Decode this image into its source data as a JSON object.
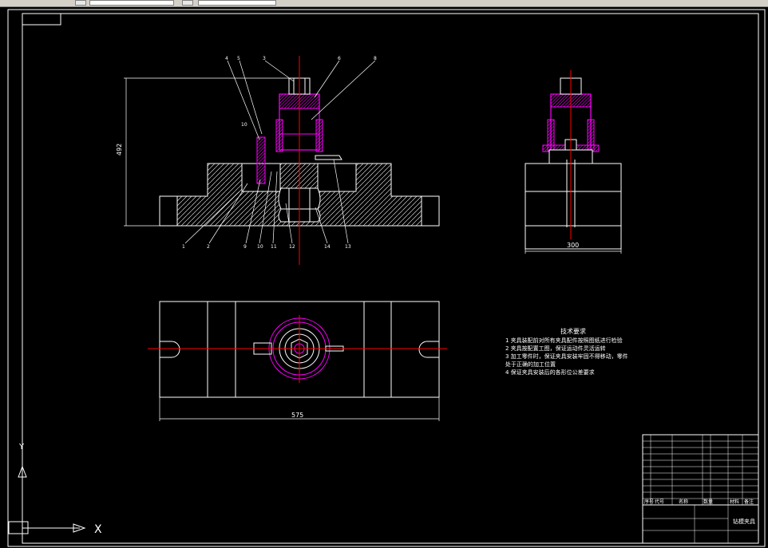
{
  "drawing": {
    "dim_height": "492",
    "dim_side_width": "300",
    "dim_top_width": "575",
    "callouts_top": [
      "4",
      "5",
      "3",
      "6",
      "8"
    ],
    "callouts_bottom": [
      "1",
      "2",
      "9",
      "10",
      "11",
      "12",
      "14",
      "13"
    ],
    "label_pin": "10",
    "tech_title": "技术要求",
    "tech_items": [
      "1  夹具装配前对所有夹具配件按照图纸进行检验",
      "2  夹具按配置工图，保证运动件灵活运转",
      "3  加工零件时，保证夹具安装牢固不得移动，零件",
      "   处于正确的加工位置",
      "4  保证夹具安装后的各形位公差要求"
    ],
    "title_block_name": "钻模夹具",
    "title_block_heads": [
      "序号",
      "代号",
      "名称",
      "数量",
      "材料",
      "备注"
    ]
  },
  "ucs": {
    "y_label": "Y",
    "x_label": "X"
  },
  "colors": {
    "line": "#ffffff",
    "accent": "#ff00ff",
    "center": "#ff0000"
  }
}
